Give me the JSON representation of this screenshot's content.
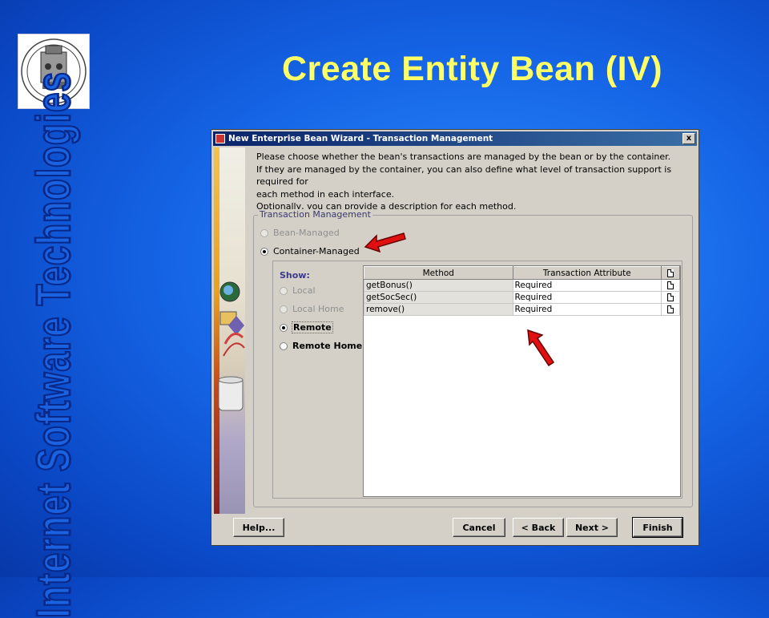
{
  "slide": {
    "title": "Create Entity Bean (IV)",
    "side_title": "Internet Software Technologies",
    "logo_text": "PISA"
  },
  "dialog": {
    "title": "New Enterprise Bean Wizard - Transaction Management",
    "close_label": "x",
    "instructions": [
      "Please choose whether the bean's transactions are managed by the bean or by the container.",
      "If they are managed by the container, you can also define what level of transaction support is required for",
      "each method in each interface.",
      "Optionally, you can provide a description for each method."
    ],
    "group_title": "Transaction Management",
    "options": {
      "bean_managed": "Bean-Managed",
      "container_managed": "Container-Managed"
    },
    "show": {
      "label": "Show:",
      "local": "Local",
      "local_home": "Local Home",
      "remote": "Remote",
      "remote_home": "Remote Home",
      "selected": "Remote"
    },
    "table": {
      "headers": [
        "Method",
        "Transaction Attribute"
      ],
      "rows": [
        {
          "method": "getBonus()",
          "attribute": "Required"
        },
        {
          "method": "getSocSec()",
          "attribute": "Required"
        },
        {
          "method": "remove()",
          "attribute": "Required"
        }
      ]
    },
    "buttons": {
      "help": "Help...",
      "cancel": "Cancel",
      "back": "< Back",
      "next": "Next >",
      "finish": "Finish"
    }
  },
  "colors": {
    "title": "#ffff66",
    "background": "#1565e6",
    "arrow": "#e01010"
  }
}
